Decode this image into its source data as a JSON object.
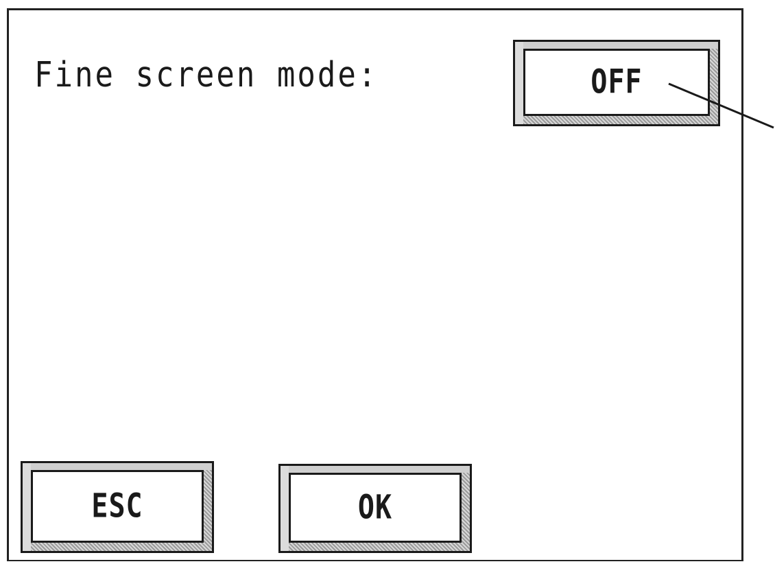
{
  "dialog": {
    "mode_label": "Fine screen mode:",
    "toggle_value": "OFF"
  },
  "buttons": {
    "esc_label": "ESC",
    "ok_label": "OK"
  }
}
